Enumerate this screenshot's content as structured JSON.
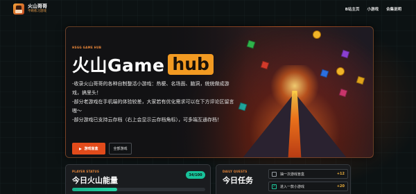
{
  "brand": {
    "name": "火山哥哥",
    "subtitle": "不断练习游戏"
  },
  "nav": {
    "items": [
      "B站主页",
      "小游戏",
      "合集说明"
    ]
  },
  "hero": {
    "tag": "HSGG GAME HUB",
    "title_main": "火山Game",
    "title_accent": "hub",
    "description": [
      "-收录火山哥哥的各种自制整活小游戏：热梗、名场面、脑洞，统统做成游戏，搞里头！",
      "-部分老游戏在手机端的体验较差，大家若有优化需求可以在下方评论区留言嗷～",
      "-部分游戏已支持云存档（右上会显示云存档角标），可多端互通存档！"
    ],
    "primary_button": "游戏盲盒",
    "secondary_button": "全部游戏"
  },
  "player_status": {
    "label": "PLAYER STATUS",
    "title": "今日火山能量",
    "energy_text": "34/100",
    "energy_value": 34,
    "energy_max": 100
  },
  "daily_quests": {
    "label": "DAILY QUESTS",
    "title": "今日任务",
    "items": [
      {
        "label": "抽一次游戏盲盒",
        "reward": "+12",
        "done": false
      },
      {
        "label": "进入一款小游戏",
        "reward": "+20",
        "done": true
      }
    ]
  },
  "colors": {
    "accent": "#f29a22",
    "primary_button": "#e24b1b",
    "energy": "#18c29a"
  },
  "icons": {
    "play": "play-icon",
    "check": "check-icon"
  }
}
